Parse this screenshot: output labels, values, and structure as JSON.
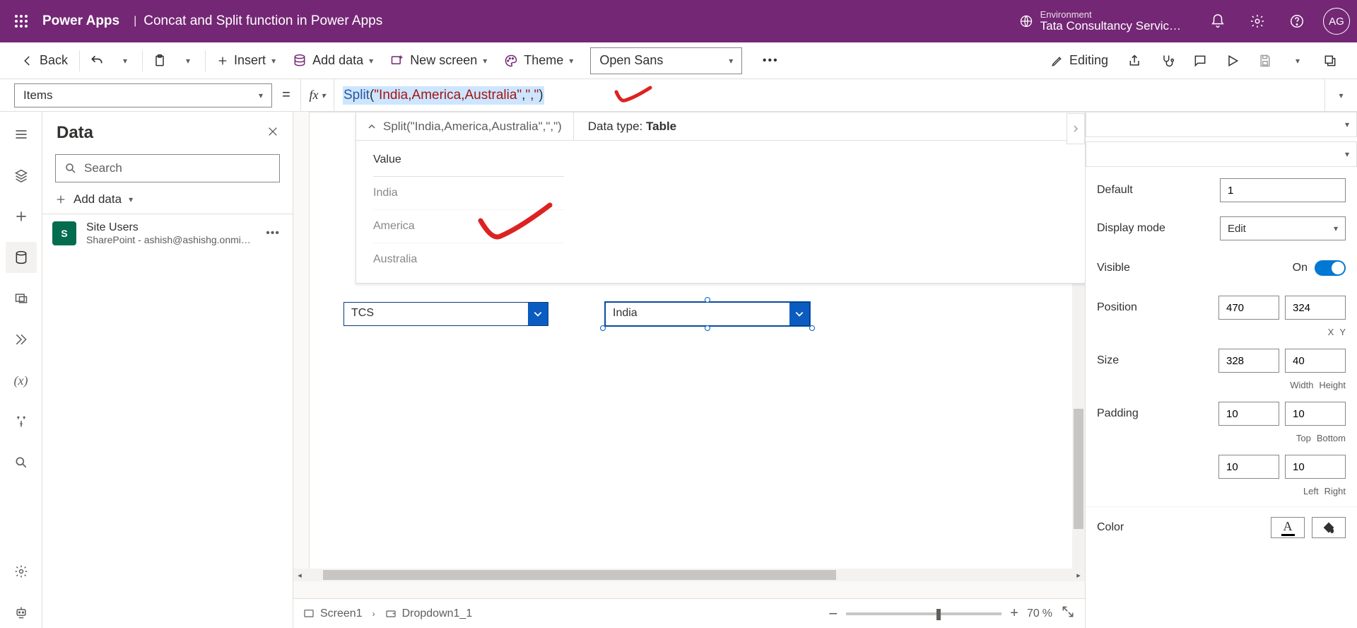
{
  "header": {
    "brand": "Power Apps",
    "separator": "|",
    "title": "Concat and Split function in Power Apps",
    "env_label": "Environment",
    "env_value": "Tata Consultancy Servic…",
    "avatar": "AG"
  },
  "command_bar": {
    "back": "Back",
    "insert": "Insert",
    "add_data": "Add data",
    "new_screen": "New screen",
    "theme": "Theme",
    "font": "Open Sans",
    "editing": "Editing"
  },
  "property_selector": {
    "property": "Items",
    "equals": "="
  },
  "formula": {
    "fn": "Split",
    "open": "(",
    "arg1": "\"India,America,Australia\"",
    "comma": ",",
    "arg2": "\",\"",
    "close": ")"
  },
  "result_popover": {
    "collapsed_formula": "Split(\"India,America,Australia\",\",\")",
    "datatype_label": "Data type: ",
    "datatype_value": "Table",
    "column_header": "Value",
    "rows": [
      "India",
      "America",
      "Australia"
    ]
  },
  "data_panel": {
    "title": "Data",
    "search_placeholder": "Search",
    "add_data": "Add data",
    "sources": [
      {
        "name": "Site Users",
        "sub": "SharePoint - ashish@ashishg.onmicroso…",
        "badge": "S"
      }
    ]
  },
  "canvas": {
    "dropdown1_value": "TCS",
    "dropdown2_value": "India"
  },
  "breadcrumb": {
    "screen": "Screen1",
    "control": "Dropdown1_1"
  },
  "zoom": {
    "value": "70",
    "pct": "%"
  },
  "properties": {
    "default_label": "Default",
    "default_value": "1",
    "display_mode_label": "Display mode",
    "display_mode_value": "Edit",
    "visible_label": "Visible",
    "visible_toggle": "On",
    "position_label": "Position",
    "position_x": "470",
    "position_y": "324",
    "position_x_sub": "X",
    "position_y_sub": "Y",
    "size_label": "Size",
    "size_w": "328",
    "size_h": "40",
    "size_w_sub": "Width",
    "size_h_sub": "Height",
    "padding_label": "Padding",
    "padding_top": "10",
    "padding_bottom": "10",
    "padding_top_sub": "Top",
    "padding_bottom_sub": "Bottom",
    "padding_left": "10",
    "padding_right": "10",
    "padding_left_sub": "Left",
    "padding_right_sub": "Right",
    "color_label": "Color"
  }
}
